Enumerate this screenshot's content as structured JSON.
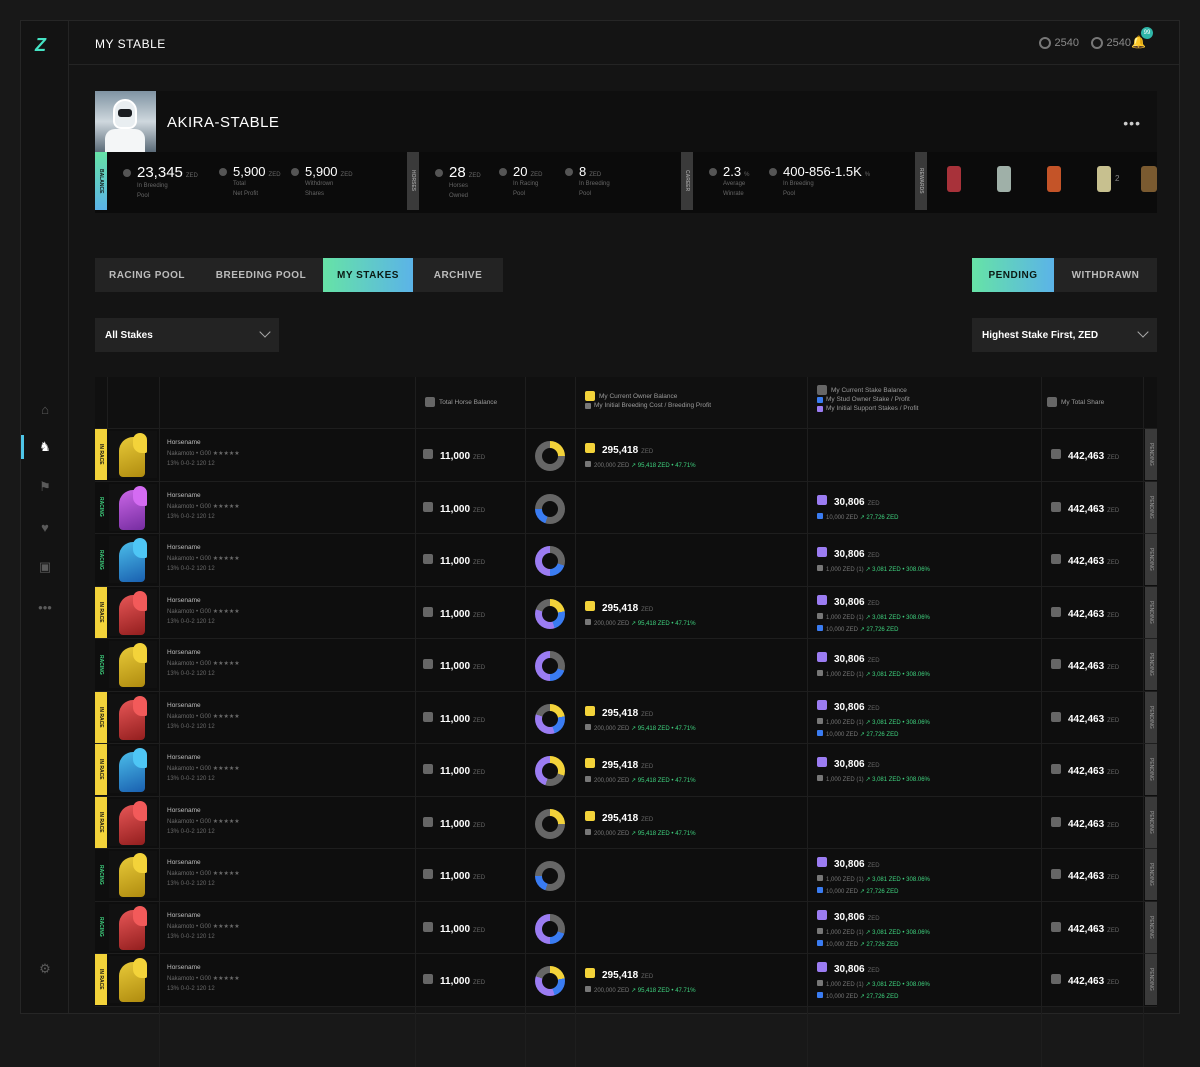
{
  "app": {
    "logo": "Z",
    "title": "MY STABLE"
  },
  "balances": [
    {
      "icon": "zed-coin-icon",
      "value": "2540"
    },
    {
      "icon": "az-coin-icon",
      "value": "2540"
    }
  ],
  "notifications": {
    "badge": "99"
  },
  "sidebar": {
    "items": [
      "home-icon",
      "horse-icon",
      "flag-icon",
      "heart-icon",
      "shop-icon",
      "more-icon"
    ],
    "bottom": "settings-icon"
  },
  "stable": {
    "name": "AKIRA-STABLE",
    "menu": "•••",
    "balance_tab": "BALANCE",
    "horses_tab": "HORSES",
    "career_tab": "CAREER",
    "rewards_tab": "REWARDS",
    "stats": {
      "breeding_pool": {
        "value": "23,345",
        "unit": "ZED",
        "label1": "In Breeding",
        "label2": "Pool"
      },
      "net_profit": {
        "value": "5,900",
        "unit": "ZED",
        "label1": "Total",
        "label2": "Net Profit"
      },
      "withdrawn": {
        "value": "5,900",
        "unit": "ZED",
        "label1": "Withdrown",
        "label2": "Shares"
      },
      "horses_owned": {
        "value": "28",
        "unit": "ZED",
        "label1": "Horses",
        "label2": "Owned"
      },
      "racing_pool": {
        "value": "20",
        "unit": "ZED",
        "label1": "In Racing",
        "label2": "Pool"
      },
      "breeding": {
        "value": "8",
        "unit": "ZED",
        "label1": "In Breeding",
        "label2": "Pool"
      },
      "winrate": {
        "value": "2.3",
        "unit": "%",
        "label1": "Average",
        "label2": "Winrate"
      },
      "breed_range": {
        "value": "400-856-1.5K",
        "unit": "%",
        "label1": "In Breeding",
        "label2": "Pool"
      }
    },
    "reward_count": "2"
  },
  "tabs": [
    {
      "label": "RACING POOL"
    },
    {
      "label": "BREEDING POOL"
    },
    {
      "label": "MY STAKES"
    },
    {
      "label": "ARCHIVE"
    }
  ],
  "status_tabs": [
    {
      "label": "PENDING"
    },
    {
      "label": "WITHDRAWN"
    }
  ],
  "filters": {
    "stakes": "All Stakes",
    "sort": "Highest Stake First, ZED"
  },
  "table": {
    "headers": {
      "total_horse_balance": "Total Horse Balance",
      "owner_balance": "My Current Owner Balance",
      "owner_sub": "My Initial Breeding Cost / Breeding Profit",
      "stake_balance": "My Current Stake Balance",
      "stake_sub1": "My Stud Owner Stake / Profit",
      "stake_sub2": "My Initial Support Stakes / Profit",
      "total_share": "My Total Share"
    },
    "rows": [
      {
        "status": "IN RACE",
        "horse_color": "gold",
        "name": "Horsename",
        "sub": "Nakamoto • G00 ★★★★★",
        "stats": "13%  0-0-2  120  12",
        "balance": "11,000",
        "unit": "ZED",
        "owner": {
          "value": "295,418",
          "cost": "200,000 ZED",
          "profit": "95,418 ZED • 47.71%"
        },
        "stake": null,
        "share": "442,463",
        "pend": "PENDING",
        "donut": "a"
      },
      {
        "status": "RACING",
        "horse_color": "purple",
        "name": "Horsename",
        "sub": "Nakamoto • G00 ★★★★★",
        "stats": "13%  0-0-2  120  12",
        "balance": "11,000",
        "unit": "ZED",
        "owner": null,
        "stake": {
          "value": "30,806",
          "lines": [
            {
              "kind": "b",
              "text": "10,000 ZED",
              "profit": "27,726 ZED"
            }
          ]
        },
        "share": "442,463",
        "pend": "PENDING",
        "donut": "b"
      },
      {
        "status": "RACING",
        "horse_color": "blue",
        "name": "Horsename",
        "sub": "Nakamoto • G00 ★★★★★",
        "stats": "13%  0-0-2  120  12",
        "balance": "11,000",
        "unit": "ZED",
        "owner": null,
        "stake": {
          "value": "30,806",
          "lines": [
            {
              "kind": "g",
              "text": "1,000 ZED (1)",
              "profit": "3,081 ZED • 308.06%"
            }
          ]
        },
        "share": "442,463",
        "pend": "PENDING",
        "donut": "c"
      },
      {
        "status": "IN RACE",
        "horse_color": "red",
        "name": "Horsename",
        "sub": "Nakamoto • G00 ★★★★★",
        "stats": "13%  0-0-2  120  12",
        "balance": "11,000",
        "unit": "ZED",
        "owner": {
          "value": "295,418",
          "cost": "200,000 ZED",
          "profit": "95,418 ZED • 47.71%"
        },
        "stake": {
          "value": "30,806",
          "lines": [
            {
              "kind": "g",
              "text": "1,000 ZED (1)",
              "profit": "3,081 ZED • 308.06%"
            },
            {
              "kind": "b",
              "text": "10,000 ZED",
              "profit": "27,726 ZED"
            }
          ]
        },
        "share": "442,463",
        "pend": "PENDING",
        "donut": "d"
      },
      {
        "status": "RACING",
        "horse_color": "gold",
        "name": "Horsename",
        "sub": "Nakamoto • G00 ★★★★★",
        "stats": "13%  0-0-2  120  12",
        "balance": "11,000",
        "unit": "ZED",
        "owner": null,
        "stake": {
          "value": "30,806",
          "lines": [
            {
              "kind": "g",
              "text": "1,000 ZED (1)",
              "profit": "3,081 ZED • 308.06%"
            }
          ]
        },
        "share": "442,463",
        "pend": "PENDING",
        "donut": "c"
      },
      {
        "status": "IN RACE",
        "horse_color": "red",
        "name": "Horsename",
        "sub": "Nakamoto • G00 ★★★★★",
        "stats": "13%  0-0-2  120  12",
        "balance": "11,000",
        "unit": "ZED",
        "owner": {
          "value": "295,418",
          "cost": "200,000 ZED",
          "profit": "95,418 ZED • 47.71%"
        },
        "stake": {
          "value": "30,806",
          "lines": [
            {
              "kind": "g",
              "text": "1,000 ZED (1)",
              "profit": "3,081 ZED • 308.06%"
            },
            {
              "kind": "b",
              "text": "10,000 ZED",
              "profit": "27,726 ZED"
            }
          ]
        },
        "share": "442,463",
        "pend": "PENDING",
        "donut": "d"
      },
      {
        "status": "IN RACE",
        "horse_color": "blue",
        "name": "Horsename",
        "sub": "Nakamoto • G00 ★★★★★",
        "stats": "13%  0-0-2  120  12",
        "balance": "11,000",
        "unit": "ZED",
        "owner": {
          "value": "295,418",
          "cost": "200,000 ZED",
          "profit": "95,418 ZED • 47.71%"
        },
        "stake": {
          "value": "30,806",
          "lines": [
            {
              "kind": "g",
              "text": "1,000 ZED (1)",
              "profit": "3,081 ZED • 308.06%"
            }
          ]
        },
        "share": "442,463",
        "pend": "PENDING",
        "donut": "e"
      },
      {
        "status": "IN RACE",
        "horse_color": "red",
        "name": "Horsename",
        "sub": "Nakamoto • G00 ★★★★★",
        "stats": "13%  0-0-2  120  12",
        "balance": "11,000",
        "unit": "ZED",
        "owner": {
          "value": "295,418",
          "cost": "200,000 ZED",
          "profit": "95,418 ZED • 47.71%"
        },
        "stake": null,
        "share": "442,463",
        "pend": "PENDING",
        "donut": "a"
      },
      {
        "status": "RACING",
        "horse_color": "gold",
        "name": "Horsename",
        "sub": "Nakamoto • G00 ★★★★★",
        "stats": "13%  0-0-2  120  12",
        "balance": "11,000",
        "unit": "ZED",
        "owner": null,
        "stake": {
          "value": "30,806",
          "lines": [
            {
              "kind": "g",
              "text": "1,000 ZED (1)",
              "profit": "3,081 ZED • 308.06%"
            },
            {
              "kind": "b",
              "text": "10,000 ZED",
              "profit": "27,726 ZED"
            }
          ]
        },
        "share": "442,463",
        "pend": "PENDING",
        "donut": "b"
      },
      {
        "status": "RACING",
        "horse_color": "red",
        "name": "Horsename",
        "sub": "Nakamoto • G00 ★★★★★",
        "stats": "13%  0-0-2  120  12",
        "balance": "11,000",
        "unit": "ZED",
        "owner": null,
        "stake": {
          "value": "30,806",
          "lines": [
            {
              "kind": "g",
              "text": "1,000 ZED (1)",
              "profit": "3,081 ZED • 308.06%"
            },
            {
              "kind": "b",
              "text": "10,000 ZED",
              "profit": "27,726 ZED"
            }
          ]
        },
        "share": "442,463",
        "pend": "PENDING",
        "donut": "c"
      },
      {
        "status": "IN RACE",
        "horse_color": "gold",
        "name": "Horsename",
        "sub": "Nakamoto • G00 ★★★★★",
        "stats": "13%  0-0-2  120  12",
        "balance": "11,000",
        "unit": "ZED",
        "owner": {
          "value": "295,418",
          "cost": "200,000 ZED",
          "profit": "95,418 ZED • 47.71%"
        },
        "stake": {
          "value": "30,806",
          "lines": [
            {
              "kind": "g",
              "text": "1,000 ZED (1)",
              "profit": "3,081 ZED • 308.06%"
            },
            {
              "kind": "b",
              "text": "10,000 ZED",
              "profit": "27,726 ZED"
            }
          ]
        },
        "share": "442,463",
        "pend": "PENDING",
        "donut": "d"
      }
    ]
  },
  "colors": {
    "accent_green": "#66e3a6",
    "accent_blue": "#5bb3e8",
    "in_race": "#f3d33a",
    "racing": "#3fd37f",
    "purple": "#9b7cf2"
  }
}
